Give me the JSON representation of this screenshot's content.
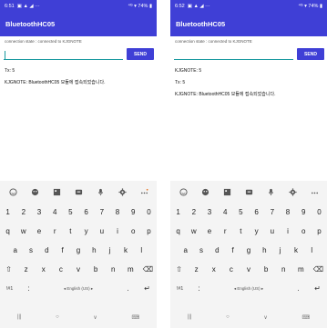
{
  "screens": [
    {
      "status": {
        "time": "6:51",
        "icons": "▣ ▲ ◢ ···",
        "right": "⁴ᴳ ▾ 74% ▮"
      },
      "title": "BluetoothHC05",
      "connection": "connection state : connected to KJGNOTE",
      "input": {
        "value": "",
        "placeholder": ""
      },
      "send_label": "SEND",
      "messages": [
        "Tx: 5",
        "KJGNOTE: BluetoothHC05 모듈에 접속되었습니다."
      ]
    },
    {
      "status": {
        "time": "6:52",
        "icons": "▣ ▲ ◢ ···",
        "right": "⁴ᴳ ▾ 74% ▮"
      },
      "title": "BluetoothHC05",
      "connection": "connection state : connected to KJGNOTE",
      "input": {
        "value": "",
        "placeholder": ""
      },
      "send_label": "SEND",
      "messages": [
        "KJGNOTE: 5",
        "Tx: 5",
        "KJGNOTE: BluetoothHC05 모듈에 접속되었습니다."
      ]
    }
  ],
  "keyboard": {
    "toolbar_icons": [
      "emoji-smile-icon",
      "sticker-icon",
      "gif-icon",
      "clipboard-icon",
      "mic-icon",
      "settings-icon",
      "more-icon"
    ],
    "rows": [
      [
        "1",
        "2",
        "3",
        "4",
        "5",
        "6",
        "7",
        "8",
        "9",
        "0"
      ],
      [
        "q",
        "w",
        "e",
        "r",
        "t",
        "y",
        "u",
        "i",
        "o",
        "p"
      ],
      [
        "a",
        "s",
        "d",
        "f",
        "g",
        "h",
        "j",
        "k",
        "l"
      ],
      [
        "⇧",
        "z",
        "x",
        "c",
        "v",
        "b",
        "n",
        "m",
        "⌫"
      ]
    ],
    "symbols_key": "!#1",
    "colon_key": ":",
    "space_label": "◂ English (US) ▸",
    "period_key": ".",
    "enter_key": "↵"
  },
  "nav": {
    "recents": "|||",
    "home": "○",
    "back": "∨",
    "keyboard": "⌨"
  }
}
